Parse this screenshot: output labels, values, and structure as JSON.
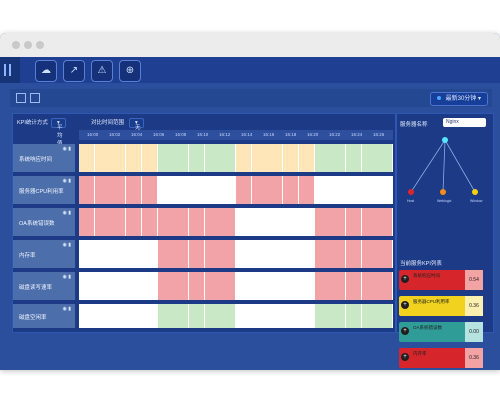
{
  "toolbar": {
    "time_range": "最新30分钟"
  },
  "main": {
    "kpi_method_label": "KPI统计方式",
    "kpi_method_value": "平均值",
    "compare_label": "对比时间范围",
    "compare_value": "无",
    "timeline": [
      "16:00",
      "16:02",
      "16:04",
      "16:06",
      "16:08",
      "16:10",
      "16:12",
      "16:14",
      "16:16",
      "16:18",
      "16:20",
      "16:22",
      "16:24",
      "16:26"
    ],
    "rows": [
      {
        "label": "系统响应时间"
      },
      {
        "label": "服务器CPU利用率"
      },
      {
        "label": "OA系统错误数"
      },
      {
        "label": "内存率"
      },
      {
        "label": "磁盘读写速率"
      },
      {
        "label": "磁盘空闲率"
      }
    ]
  },
  "side": {
    "server_label": "服务器名称",
    "server_value": "Nginx",
    "nodes": [
      "Host",
      "Weblogic",
      "Window"
    ],
    "list_title": "当前服务KPI列表",
    "kpis": [
      {
        "name": "系统响应时间",
        "value": "0.54",
        "bg": "#d7262b",
        "val_bg": "#f4a3a5"
      },
      {
        "name": "服务器CPU利用率",
        "value": "0.36",
        "bg": "#f1d21e",
        "val_bg": "#fbf0b0"
      },
      {
        "name": "OA系统错误数",
        "value": "0.00",
        "bg": "#2f9c98",
        "val_bg": "#b5e3e0"
      },
      {
        "name": "内存率",
        "value": "0.36",
        "bg": "#d7262b",
        "val_bg": "#f4a3a5"
      }
    ]
  }
}
